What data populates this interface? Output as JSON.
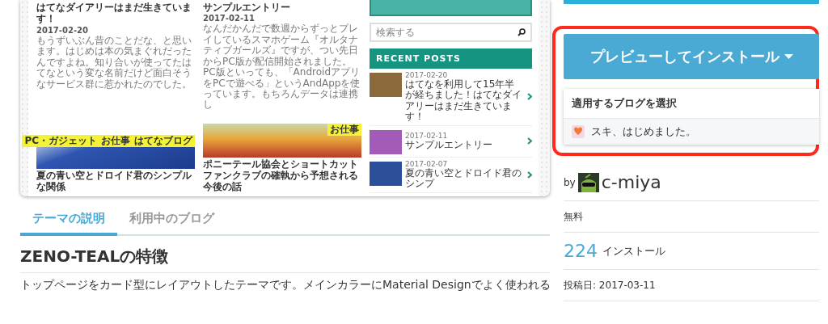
{
  "preview": {
    "posts": [
      {
        "title": "はてなダイアリーはまだ生きています！",
        "date": "2017-02-20",
        "excerpt": "もうずいぶん昔のことだな、と思います。はじめは本の気まぐれだったんですよね。知り合いが使ってたはてなという変な名前だけど面白そうなサービス群に惹かれたのでした。"
      },
      {
        "title": "サンプルエントリー",
        "date": "2017-02-11",
        "excerpt": "なんだかんだで数週からずっとプレイしているスマホゲーム『オルタナティブガールズ』ですが、つい先日からPC版が配信開始されました。PC版といっても、「AndroidアプリをPCで遊べる」というAndAppを使っています。もちろんデータは連携し"
      }
    ],
    "cards": [
      {
        "tags": [
          "PC・ガジェット",
          "お仕事",
          "はてなブログ"
        ],
        "title": "夏の青い空とドロイド君のシンプルな関係"
      },
      {
        "tags": [
          "お仕事"
        ],
        "title": "ポニーテール協会とショートカットファンクラブの確執から予想される今後の話"
      }
    ],
    "search": {
      "placeholder": "検索する"
    },
    "recent_posts": {
      "heading": "RECENT POSTS",
      "items": [
        {
          "date": "2017-02-20",
          "title": "はてなを利用して15年半が経ちました！はてなダイアリーはまだ生きています！"
        },
        {
          "date": "2017-02-11",
          "title": "サンプルエントリー"
        },
        {
          "date": "2017-02-07",
          "title": "夏の青い空とドロイド君のシンプ"
        }
      ]
    }
  },
  "tabs": [
    {
      "label": "テーマの説明",
      "selected": true
    },
    {
      "label": "利用中のブログ",
      "selected": false
    }
  ],
  "section": {
    "heading": "ZENO-TEALの特徴",
    "text": "トップページをカード型にレイアウトしたテーマです。メインカラーにMaterial Designでよく使われる"
  },
  "install_button": {
    "label": "プレビューしてインストール"
  },
  "blog_select": {
    "heading": "適用するブログを選択",
    "blogs": [
      {
        "name": "スキ、はじめました。"
      }
    ]
  },
  "author": {
    "by": "by",
    "name": "c-miya"
  },
  "price": "無料",
  "installs": {
    "count": "224",
    "label": "インストール"
  },
  "posted": "投稿日: 2017-03-11"
}
